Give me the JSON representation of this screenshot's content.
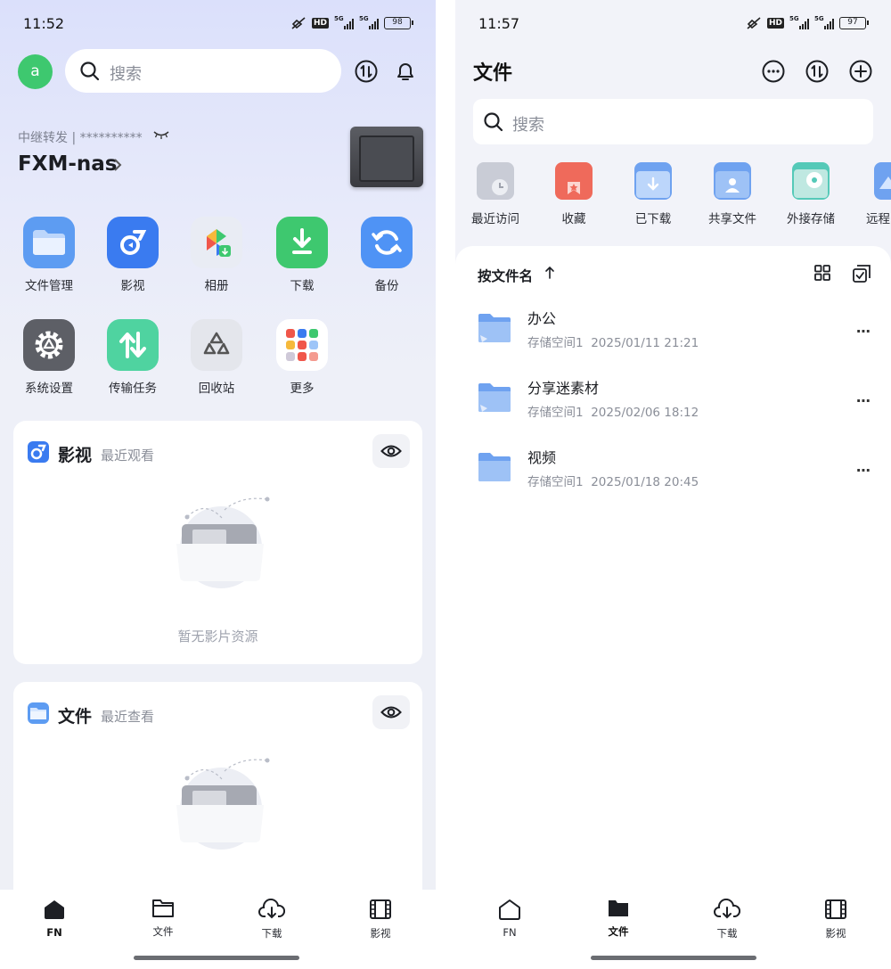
{
  "left": {
    "status": {
      "time": "11:52",
      "battery": "98",
      "hd": "HD",
      "net": "5G"
    },
    "avatar_letter": "a",
    "search_placeholder": "搜索",
    "relay": "中继转发 | **********",
    "nas_name": "FXM-nas",
    "apps": [
      {
        "label": "文件管理",
        "icon": "folder-icon",
        "color": "#5d9cf2"
      },
      {
        "label": "影视",
        "icon": "film-icon",
        "color": "#3a7bf0"
      },
      {
        "label": "相册",
        "icon": "photo-icon",
        "color": "#e9ecf4"
      },
      {
        "label": "下载",
        "icon": "download-icon",
        "color": "#3ec86f"
      },
      {
        "label": "备份",
        "icon": "backup-icon",
        "color": "#4f93f5"
      },
      {
        "label": "系统设置",
        "icon": "settings-icon",
        "color": "#5d5f66"
      },
      {
        "label": "传输任务",
        "icon": "transfer-icon",
        "color": "#4fd3a0"
      },
      {
        "label": "回收站",
        "icon": "recycle-icon",
        "color": "#e4e6ec"
      },
      {
        "label": "更多",
        "icon": "more-apps-icon",
        "color": "#ffffff"
      }
    ],
    "card_media": {
      "title": "影视",
      "subtitle": "最近观看",
      "empty": "暂无影片资源"
    },
    "card_files": {
      "title": "文件",
      "subtitle": "最近查看"
    },
    "nav": [
      {
        "label": "FN",
        "icon": "home-icon",
        "active": true
      },
      {
        "label": "文件",
        "icon": "folder-icon",
        "active": false
      },
      {
        "label": "下载",
        "icon": "download-cloud-icon",
        "active": false
      },
      {
        "label": "影视",
        "icon": "film-strip-icon",
        "active": false
      }
    ]
  },
  "right": {
    "status": {
      "time": "11:57",
      "battery": "97",
      "hd": "HD",
      "net": "5G"
    },
    "title": "文件",
    "search_placeholder": "搜索",
    "quick_access": [
      {
        "label": "最近访问",
        "icon": "recent-icon",
        "color": "#c9ccd6"
      },
      {
        "label": "收藏",
        "icon": "favorite-icon",
        "color": "#ef6a5b"
      },
      {
        "label": "已下载",
        "icon": "downloaded-icon",
        "color": "#6fa2f0"
      },
      {
        "label": "共享文件",
        "icon": "shared-icon",
        "color": "#6fa2f0"
      },
      {
        "label": "外接存储",
        "icon": "external-storage-icon",
        "color": "#55c9b8"
      },
      {
        "label": "远程",
        "icon": "remote-icon",
        "color": "#6fa2f0"
      }
    ],
    "sort_label": "按文件名",
    "files": [
      {
        "name": "办公",
        "storage": "存储空间1",
        "date": "2025/01/11 21:21"
      },
      {
        "name": "分享迷素材",
        "storage": "存储空间1",
        "date": "2025/02/06 18:12"
      },
      {
        "name": "视频",
        "storage": "存储空间1",
        "date": "2025/01/18 20:45"
      }
    ],
    "nav": [
      {
        "label": "FN",
        "icon": "home-icon",
        "active": false
      },
      {
        "label": "文件",
        "icon": "folder-icon",
        "active": true
      },
      {
        "label": "下载",
        "icon": "download-cloud-icon",
        "active": false
      },
      {
        "label": "影视",
        "icon": "film-strip-icon",
        "active": false
      }
    ]
  }
}
